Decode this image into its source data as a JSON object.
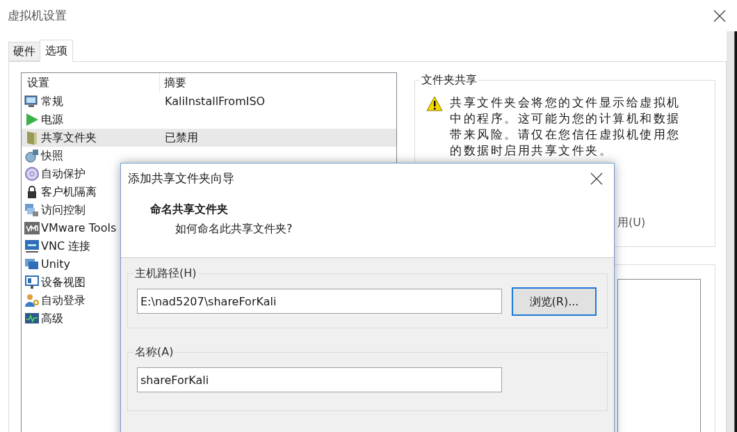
{
  "window": {
    "title": "虚拟机设置"
  },
  "tabs": [
    {
      "label": "硬件",
      "selected": false
    },
    {
      "label": "选项",
      "selected": true
    }
  ],
  "settings_list": {
    "columns": [
      "设置",
      "摘要"
    ],
    "items": [
      {
        "name": "常规",
        "summary": "KaliInstallFromISO",
        "selected": false
      },
      {
        "name": "电源",
        "selected": false
      },
      {
        "name": "共享文件夹",
        "summary": "已禁用",
        "selected": true
      },
      {
        "name": "快照",
        "selected": false
      },
      {
        "name": "自动保护",
        "selected": false
      },
      {
        "name": "客户机隔离",
        "selected": false
      },
      {
        "name": "访问控制",
        "selected": false
      },
      {
        "name": "VMware Tools",
        "selected": false
      },
      {
        "name": "VNC 连接",
        "selected": false
      },
      {
        "name": "Unity",
        "selected": false
      },
      {
        "name": "设备视图",
        "selected": false
      },
      {
        "name": "自动登录",
        "selected": false
      },
      {
        "name": "高级",
        "selected": false
      }
    ]
  },
  "folder_sharing": {
    "title": "文件夹共享",
    "warning": "共享文件夹会将您的文件显示给虚拟机中的程序。这可能为您的计算机和数据带来风险。请仅在您信任虚拟机使用您的数据时启用共享文件夹。",
    "option_partial": "用(U)"
  },
  "dialog": {
    "title": "添加共享文件夹向导",
    "heading": "命名共享文件夹",
    "subheading": "如何命名此共享文件夹?",
    "host_path": {
      "label": "主机路径(H)",
      "value": "E:\\nad5207\\shareForKali",
      "browse_button": "浏览(R)..."
    },
    "name": {
      "label": "名称(A)",
      "value": "shareForKali"
    }
  }
}
